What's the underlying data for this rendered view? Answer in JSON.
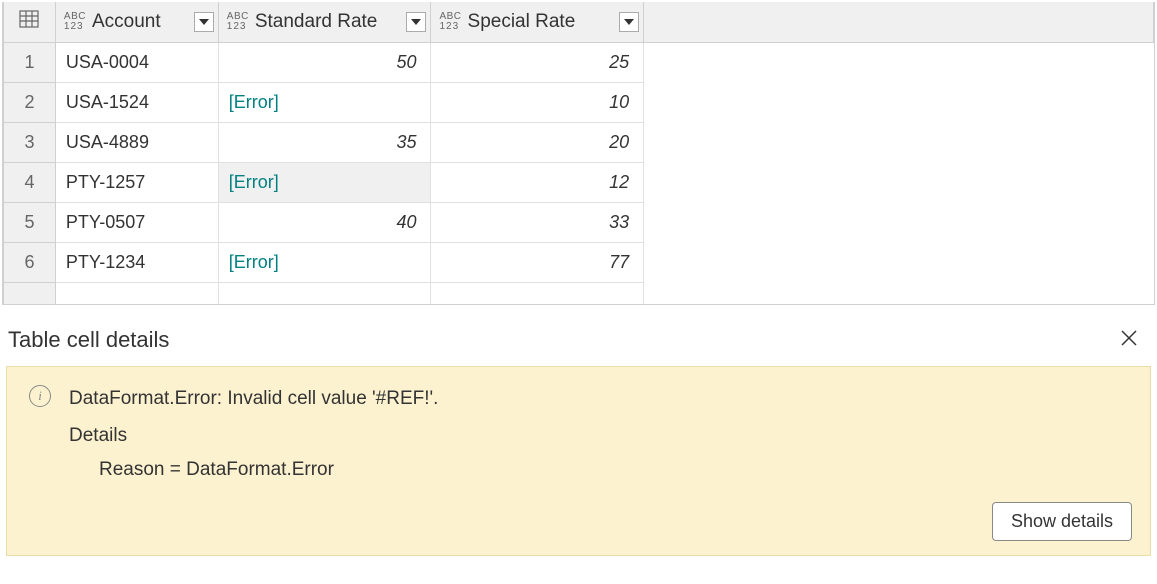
{
  "table": {
    "columns": [
      {
        "label": "Account"
      },
      {
        "label": "Standard Rate"
      },
      {
        "label": "Special Rate"
      }
    ],
    "rows": [
      {
        "num": "1",
        "account": "USA-0004",
        "std": "50",
        "std_error": false,
        "special": "25"
      },
      {
        "num": "2",
        "account": "USA-1524",
        "std": "[Error]",
        "std_error": true,
        "special": "10"
      },
      {
        "num": "3",
        "account": "USA-4889",
        "std": "35",
        "std_error": false,
        "special": "20"
      },
      {
        "num": "4",
        "account": "PTY-1257",
        "std": "[Error]",
        "std_error": true,
        "special": "12",
        "selected": true
      },
      {
        "num": "5",
        "account": "PTY-0507",
        "std": "40",
        "std_error": false,
        "special": "33"
      },
      {
        "num": "6",
        "account": "PTY-1234",
        "std": "[Error]",
        "std_error": true,
        "special": "77"
      }
    ]
  },
  "details": {
    "title": "Table cell details",
    "error_message": "DataFormat.Error: Invalid cell value '#REF!'.",
    "details_label": "Details",
    "reason_line": "Reason = DataFormat.Error",
    "show_details_label": "Show details"
  },
  "chart_data": {
    "type": "table",
    "columns": [
      "Account",
      "Standard Rate",
      "Special Rate"
    ],
    "data": [
      [
        "USA-0004",
        50,
        25
      ],
      [
        "USA-1524",
        null,
        10
      ],
      [
        "USA-4889",
        35,
        20
      ],
      [
        "PTY-1257",
        null,
        12
      ],
      [
        "PTY-0507",
        40,
        33
      ],
      [
        "PTY-1234",
        null,
        77
      ]
    ],
    "notes": "null in Standard Rate = [Error] cell (DataFormat.Error: Invalid cell value '#REF!')"
  }
}
